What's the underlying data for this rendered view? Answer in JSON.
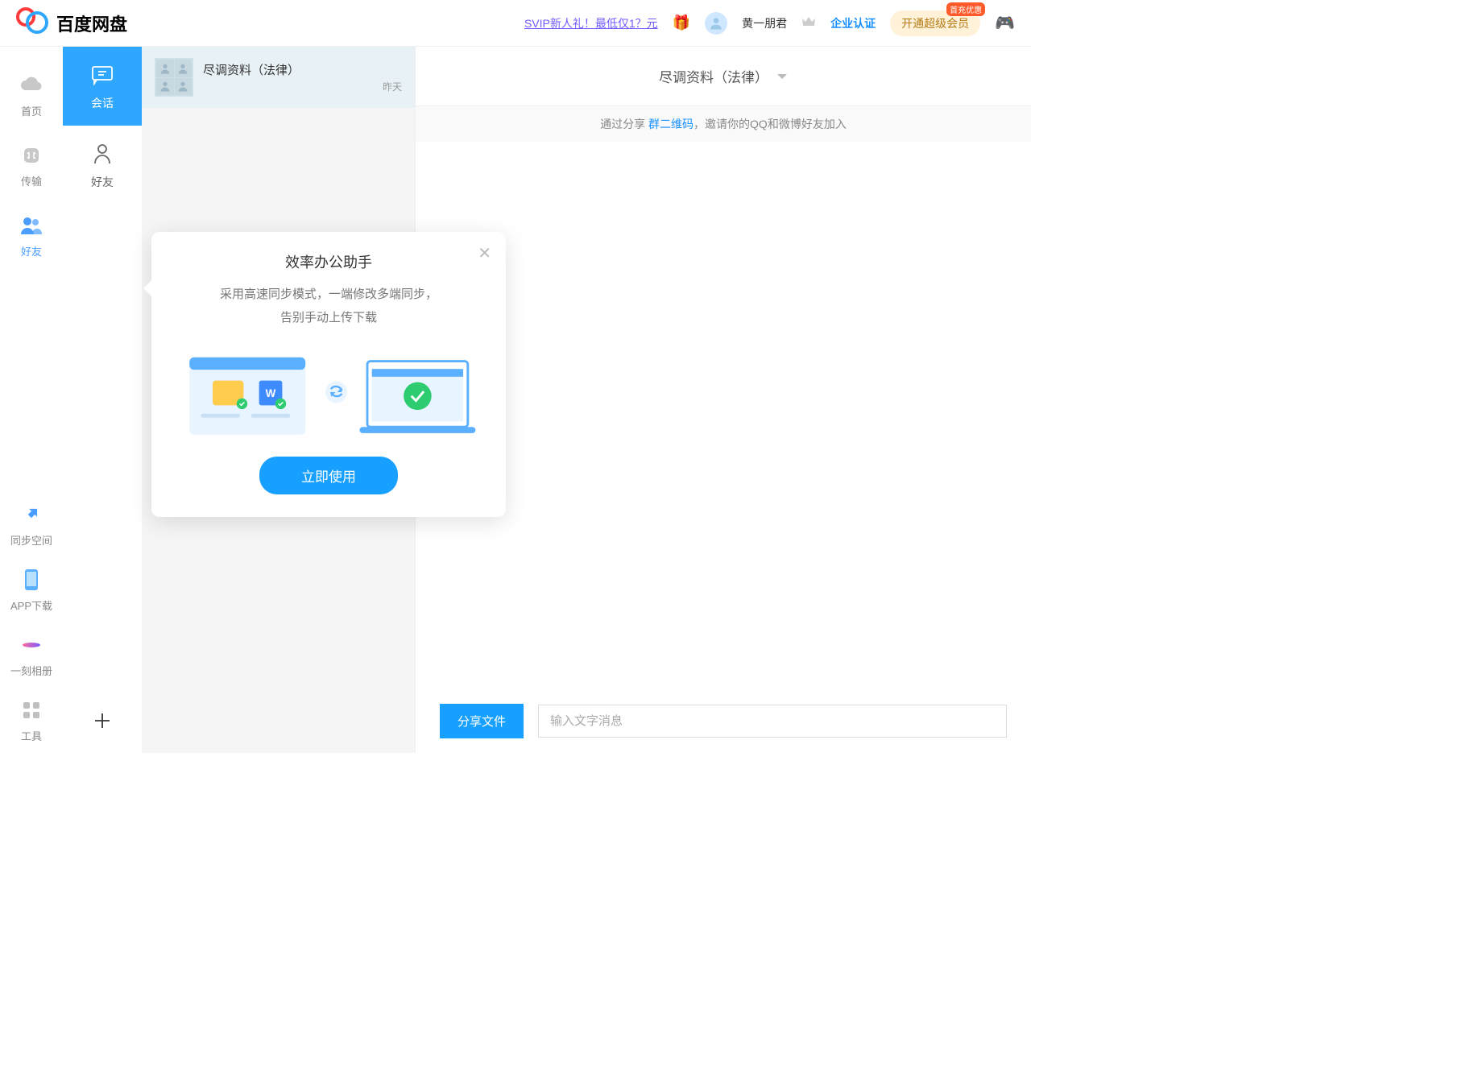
{
  "header": {
    "appName": "百度网盘",
    "svipLink": "SVIP新人礼！最低仅1？元",
    "username": "黄一朋君",
    "enterpriseLink": "企业认证",
    "svipPill": "开通超级会员",
    "svipBadge": "首充优惠"
  },
  "navLeft": {
    "items": [
      {
        "label": "首页",
        "icon": "cloud-icon"
      },
      {
        "label": "传输",
        "icon": "transfer-icon"
      },
      {
        "label": "好友",
        "icon": "friends-icon",
        "active": true
      }
    ],
    "bottom": [
      {
        "label": "同步空间",
        "icon": "sync-icon"
      },
      {
        "label": "APP下载",
        "icon": "phone-icon"
      },
      {
        "label": "一刻相册",
        "icon": "album-icon"
      },
      {
        "label": "工具",
        "icon": "tools-icon"
      }
    ]
  },
  "tabs": {
    "items": [
      {
        "label": "会话",
        "icon": "chat-icon",
        "active": true
      },
      {
        "label": "好友",
        "icon": "person-icon"
      }
    ]
  },
  "conversations": [
    {
      "title": "尽调资料（法律）",
      "time": "昨天"
    }
  ],
  "popover": {
    "title": "效率办公助手",
    "descLine1": "采用高速同步模式，一端修改多端同步，",
    "descLine2": "告别手动上传下载",
    "button": "立即使用"
  },
  "chat": {
    "headerTitle": "尽调资料（法律）",
    "inviteBefore": "通过分享 ",
    "inviteLink": "群二维码",
    "inviteAfter": "，邀请你的QQ和微博好友加入",
    "shareButton": "分享文件",
    "inputPlaceholder": "输入文字消息"
  },
  "colors": {
    "primary": "#17a0ff",
    "link": "#1890ff",
    "purple": "#6f5cff"
  }
}
